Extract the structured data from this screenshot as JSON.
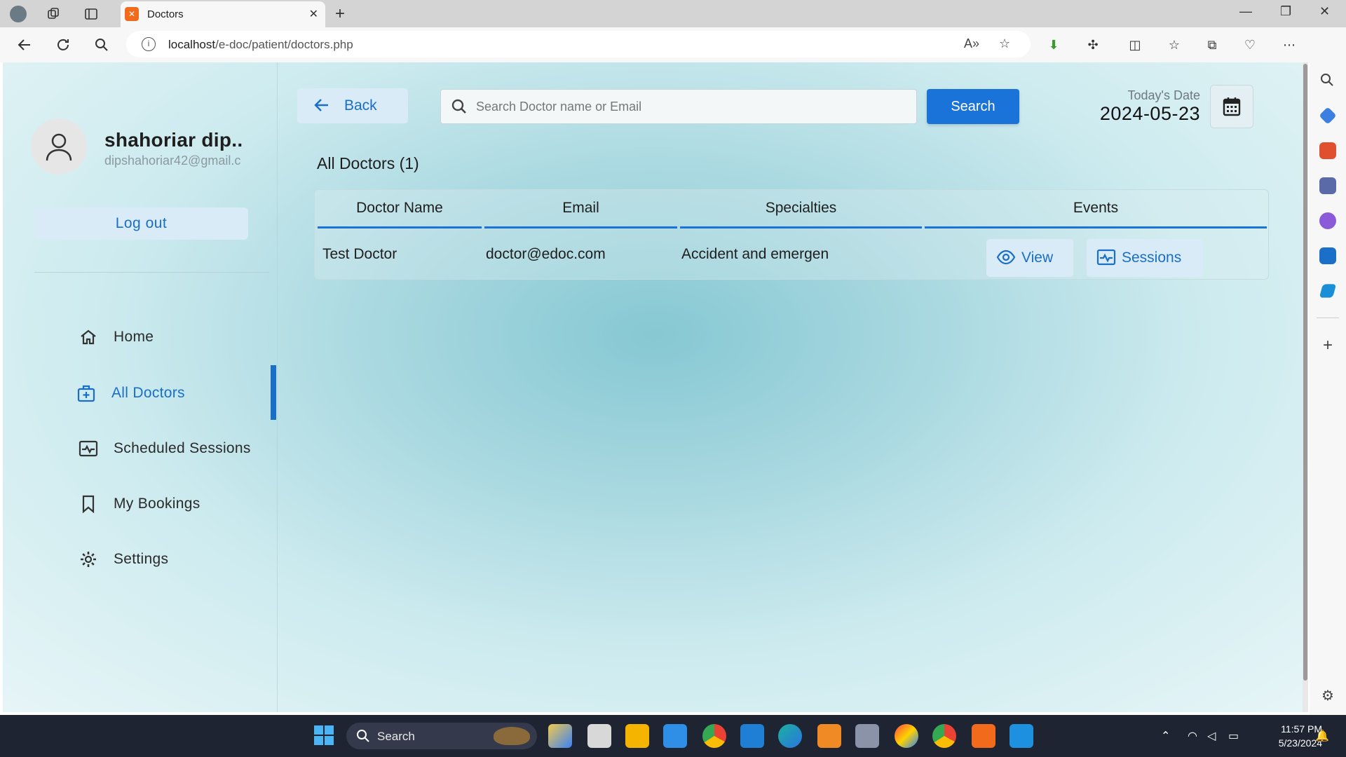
{
  "browser": {
    "tab_title": "Doctors",
    "url_host": "localhost",
    "url_path": "/e-doc/patient/doctors.php"
  },
  "user": {
    "name": "shahoriar dip..",
    "email": "dipshahoriar42@gmail.c"
  },
  "sidebar": {
    "logout_label": "Log out",
    "items": [
      {
        "label": "Home",
        "icon": "home-icon"
      },
      {
        "label": "All Doctors",
        "icon": "medical-kit-icon",
        "active": true
      },
      {
        "label": "Scheduled Sessions",
        "icon": "schedule-icon"
      },
      {
        "label": "My Bookings",
        "icon": "bookmark-icon"
      },
      {
        "label": "Settings",
        "icon": "gear-icon"
      }
    ]
  },
  "header": {
    "back_label": "Back",
    "search_placeholder": "Search Doctor name or Email",
    "search_button": "Search",
    "date_label": "Today's Date",
    "date_value": "2024-05-23"
  },
  "main": {
    "heading": "All Doctors (1)",
    "columns": [
      "Doctor Name",
      "Email",
      "Specialties",
      "Events"
    ],
    "rows": [
      {
        "name": "Test Doctor",
        "email": "doctor@edoc.com",
        "specialty": "Accident and emergen",
        "view_label": "View",
        "sessions_label": "Sessions"
      }
    ]
  },
  "taskbar": {
    "search_label": "Search",
    "time": "11:57 PM",
    "date": "5/23/2024"
  },
  "colors": {
    "accent": "#1a73d9",
    "link_blue": "#1a6fc4",
    "button_light": "#d8ebf7"
  }
}
